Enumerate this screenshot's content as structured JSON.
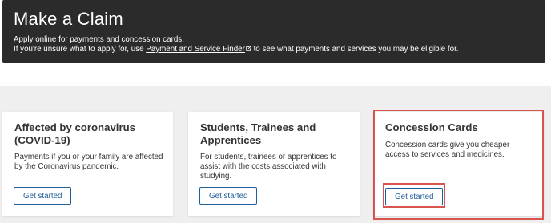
{
  "banner": {
    "title": "Make a Claim",
    "line1": "Apply online for payments and concession cards.",
    "line2_prefix": "If you're unsure what to apply for, use ",
    "link_text": "Payment and Service Finder",
    "line2_suffix": " to see what payments and services you may be eligible for."
  },
  "cards": [
    {
      "title": "Affected by coronavirus (COVID-19)",
      "description": "Payments if you or your family are affected by the Coronavirus pandemic.",
      "button": "Get started"
    },
    {
      "title": "Students, Trainees and Apprentices",
      "description": "For students, trainees or apprentices to assist with the costs associated with studying.",
      "button": "Get started"
    },
    {
      "title": "Concession Cards",
      "description": "Concession cards give you cheaper access to services and medicines.",
      "button": "Get started"
    }
  ],
  "colors": {
    "banner_bg": "#2b2b2b",
    "panel_bg": "#efefef",
    "button_blue": "#1f5f9a",
    "highlight_red": "#d9534f"
  }
}
